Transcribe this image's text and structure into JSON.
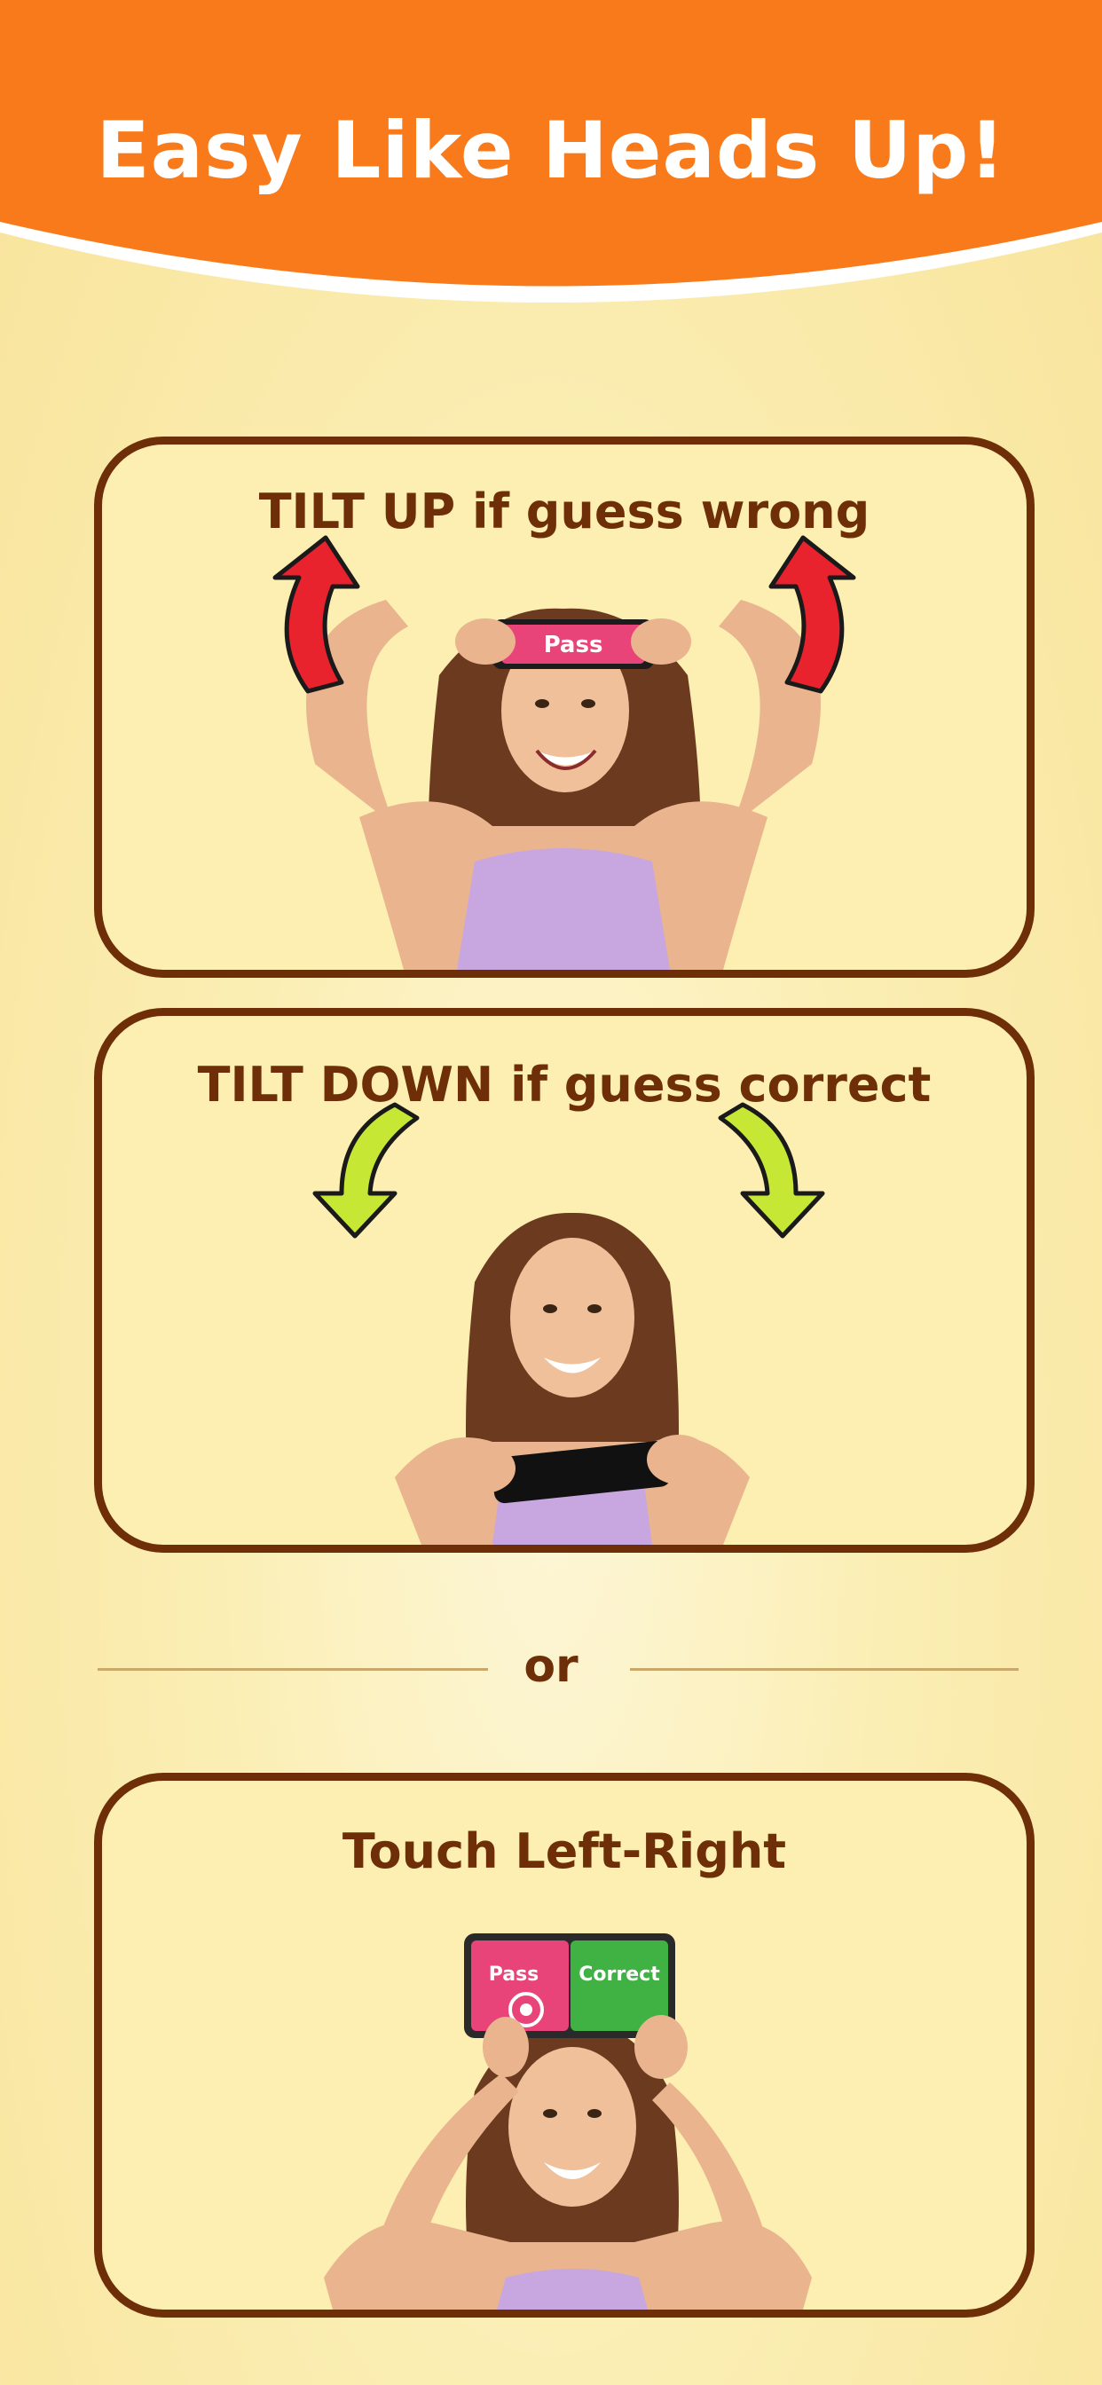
{
  "header": {
    "title": "Easy Like Heads Up!"
  },
  "cards": [
    {
      "title": "TILT UP if guess wrong",
      "phone_label": "Pass"
    },
    {
      "title": "TILT DOWN if guess correct"
    },
    {
      "title": "Touch Left-Right",
      "pass_label": "Pass",
      "correct_label": "Correct"
    }
  ],
  "separator": {
    "label": "or"
  },
  "colors": {
    "header_orange": "#f87a1a",
    "brown": "#6e2e07",
    "card_bg": "#fcefb1",
    "pass_pink": "#e9447a",
    "correct_green": "#3fb243",
    "arrow_red": "#e8232d",
    "arrow_green": "#c6e835"
  }
}
